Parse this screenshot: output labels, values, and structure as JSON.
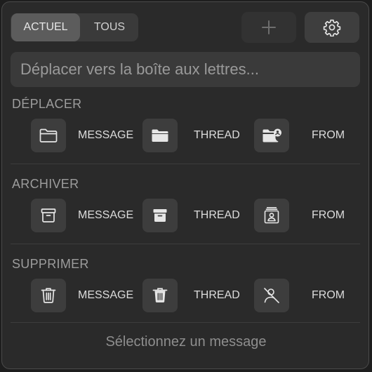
{
  "tabs": {
    "current": "ACTUEL",
    "all": "TOUS"
  },
  "toolbar": {
    "add_icon": "plus-icon",
    "settings_icon": "gear-icon"
  },
  "search": {
    "placeholder": "Déplacer vers la boîte aux lettres..."
  },
  "sections": {
    "move": {
      "title": "DÉPLACER",
      "message": "MESSAGE",
      "thread": "THREAD",
      "from": "FROM",
      "icons": [
        "folder-outline-icon",
        "folder-filled-icon",
        "folder-person-icon"
      ]
    },
    "archive": {
      "title": "ARCHIVER",
      "message": "MESSAGE",
      "thread": "THREAD",
      "from": "FROM",
      "icons": [
        "archive-box-outline-icon",
        "archive-box-filled-icon",
        "archive-person-icon"
      ]
    },
    "delete": {
      "title": "SUPPRIMER",
      "message": "MESSAGE",
      "thread": "THREAD",
      "from": "FROM",
      "icons": [
        "trash-outline-icon",
        "trash-filled-icon",
        "person-slash-icon"
      ]
    }
  },
  "footer": {
    "status": "Sélectionnez un message"
  },
  "colors": {
    "background": "#2a2a2a",
    "button": "#3d3d3d",
    "text": "#dcdcdc",
    "muted": "#9c9c9c"
  }
}
